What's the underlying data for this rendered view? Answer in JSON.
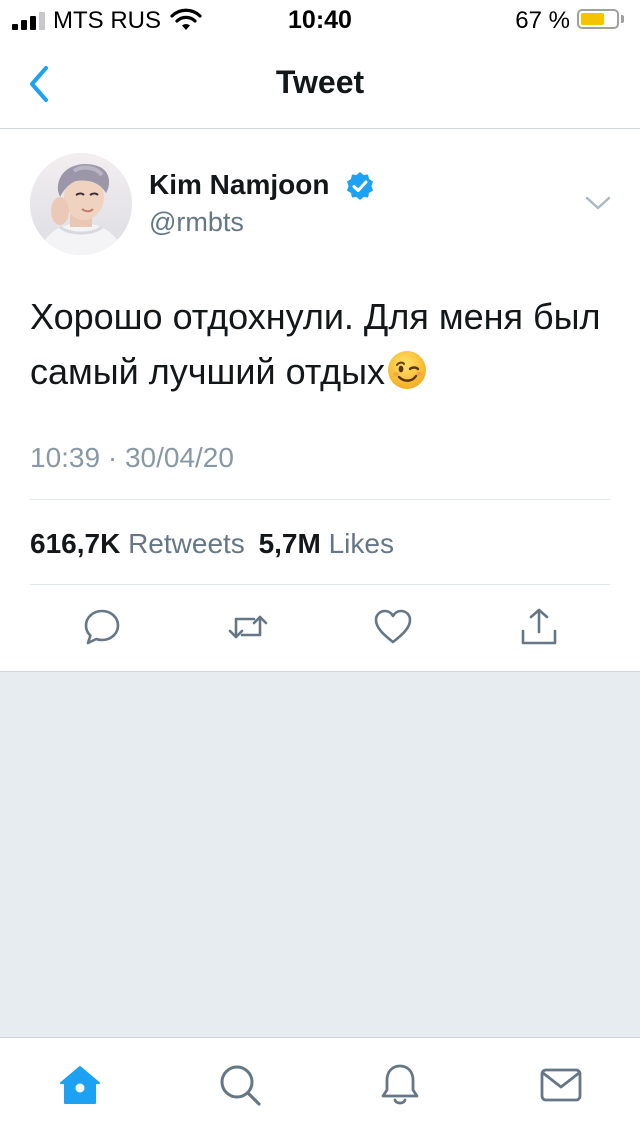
{
  "status_bar": {
    "carrier": "MTS RUS",
    "time": "10:40",
    "battery_percent_label": "67 %",
    "battery_level": 0.67,
    "battery_color": "#f5c400",
    "icons": [
      "signal-icon",
      "wifi-icon",
      "battery-icon"
    ]
  },
  "header": {
    "title": "Tweet",
    "back_icon": "chevron-left-icon",
    "accent_color": "#1da1f2"
  },
  "tweet": {
    "author_name": "Kim Namjoon",
    "verified": true,
    "handle": "@rmbts",
    "text": "Хорошо отдохнули. Для меня был самый лучший отдых",
    "emoji": "winking-face-emoji",
    "timestamp": "10:39 · 30/04/20",
    "retweets_count": "616,7K",
    "retweets_label": "Retweets",
    "likes_count": "5,7M",
    "likes_label": "Likes",
    "actions": [
      "reply-icon",
      "retweet-icon",
      "like-icon",
      "share-icon"
    ]
  },
  "tab_bar": {
    "tabs": [
      "home-icon",
      "search-icon",
      "notifications-icon",
      "messages-icon"
    ],
    "active_tab": "home-icon"
  }
}
